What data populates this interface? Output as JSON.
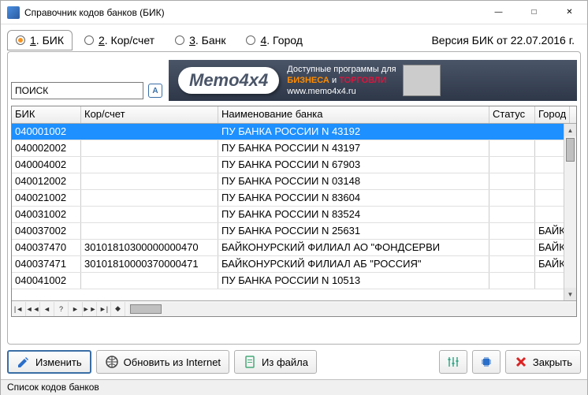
{
  "window": {
    "title": "Справочник кодов банков (БИК)"
  },
  "version": "Версия БИК от 22.07.2016 г.",
  "tabs": [
    {
      "num": "1",
      "label": "БИК",
      "active": true
    },
    {
      "num": "2",
      "label": "Кор/счет",
      "active": false
    },
    {
      "num": "3",
      "label": "Банк",
      "active": false
    },
    {
      "num": "4",
      "label": "Город",
      "active": false
    }
  ],
  "search": {
    "value": "ПОИСК",
    "az_label": "А"
  },
  "banner": {
    "logo": "Memo4x4",
    "line1_a": "Доступные программы для",
    "line1_biz": "БИЗНЕСА",
    "line1_and": " и ",
    "line1_trade": "ТОРГОВЛИ",
    "line2": "www.memo4x4.ru"
  },
  "columns": {
    "bik": "БИК",
    "kor": "Кор/счет",
    "name": "Наименование банка",
    "status": "Статус",
    "city": "Город"
  },
  "rows": [
    {
      "bik": "040001002",
      "kor": "",
      "name": "ПУ БАНКА РОССИИ N 43192",
      "status": "",
      "city": ""
    },
    {
      "bik": "040002002",
      "kor": "",
      "name": "ПУ БАНКА РОССИИ N 43197",
      "status": "",
      "city": ""
    },
    {
      "bik": "040004002",
      "kor": "",
      "name": "ПУ БАНКА РОССИИ N 67903",
      "status": "",
      "city": ""
    },
    {
      "bik": "040012002",
      "kor": "",
      "name": "ПУ БАНКА РОССИИ N 03148",
      "status": "",
      "city": ""
    },
    {
      "bik": "040021002",
      "kor": "",
      "name": "ПУ БАНКА РОССИИ N 83604",
      "status": "",
      "city": ""
    },
    {
      "bik": "040031002",
      "kor": "",
      "name": "ПУ БАНКА РОССИИ N 83524",
      "status": "",
      "city": ""
    },
    {
      "bik": "040037002",
      "kor": "",
      "name": "ПУ БАНКА РОССИИ N 25631",
      "status": "",
      "city": "БАЙК"
    },
    {
      "bik": "040037470",
      "kor": "30101810300000000470",
      "name": "БАЙКОНУРСКИЙ ФИЛИАЛ АО \"ФОНДСЕРВИ",
      "status": "",
      "city": "БАЙК"
    },
    {
      "bik": "040037471",
      "kor": "30101810000370000471",
      "name": "БАЙКОНУРСКИЙ ФИЛИАЛ АБ \"РОССИЯ\"",
      "status": "",
      "city": "БАЙК"
    },
    {
      "bik": "040041002",
      "kor": "",
      "name": "ПУ БАНКА РОССИИ N 10513",
      "status": "",
      "city": ""
    }
  ],
  "toolbar": {
    "edit": "Изменить",
    "update": "Обновить из Internet",
    "fromfile": "Из файла",
    "close": "Закрыть"
  },
  "statusbar": "Список кодов банков"
}
